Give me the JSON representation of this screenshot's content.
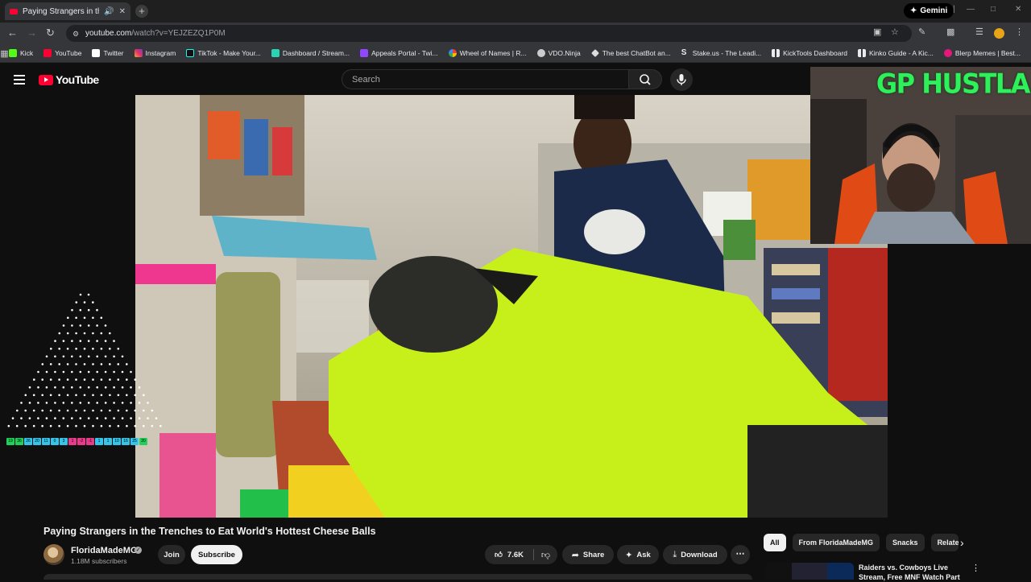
{
  "browser": {
    "tab_title": "Paying Strangers in the Tre",
    "url_host": "youtube.com",
    "url_path": "/watch?v=YEJZEZQ1P0M",
    "gemini_label": "Gemini",
    "bookmarks": [
      {
        "label": "Kick",
        "color": "#53fc18"
      },
      {
        "label": "YouTube",
        "color": "#ff0033"
      },
      {
        "label": "Twitter",
        "color": "#ffffff"
      },
      {
        "label": "Instagram",
        "color": "#e1306c"
      },
      {
        "label": "TikTok - Make Your...",
        "color": "#111111"
      },
      {
        "label": "Dashboard / Stream...",
        "color": "#2ad3b6"
      },
      {
        "label": "Appeals Portal - Twi...",
        "color": "#9146ff"
      },
      {
        "label": "Wheel of Names | R...",
        "color": "#4285f4"
      },
      {
        "label": "VDO.Ninja",
        "color": "#cccccc"
      },
      {
        "label": "The best ChatBot an...",
        "color": "#dddddd"
      },
      {
        "label": "Stake.us - The Leadi...",
        "color": "#e8eaed"
      },
      {
        "label": "KickTools Dashboard",
        "color": "#e8eaed"
      },
      {
        "label": "Kinko Guide - A Kic...",
        "color": "#e8eaed"
      },
      {
        "label": "Blerp Memes | Best...",
        "color": "#e5177b"
      }
    ]
  },
  "youtube": {
    "logo_text": "YouTube",
    "search_placeholder": "Search"
  },
  "overlay": {
    "cam_title": "GP HUSTLA",
    "counters": [
      "19",
      "36",
      "26",
      "20",
      "11",
      "0",
      "3",
      "1",
      "-2",
      "-1",
      "1",
      "1",
      "10",
      "16",
      "25",
      "20"
    ]
  },
  "video": {
    "title": "Paying Strangers in the Trenches to Eat World's Hottest Cheese Balls",
    "channel": "FloridaMadeMG",
    "subscribers": "1.18M subscribers",
    "join_label": "Join",
    "subscribe_label": "Subscribe",
    "likes": "7.6K",
    "share_label": "Share",
    "ask_label": "Ask",
    "download_label": "Download"
  },
  "sidebar": {
    "chips": [
      "All",
      "From FloridaMadeMG",
      "Snacks",
      "Relate"
    ],
    "rec_title": "Raiders vs. Cowboys Live Stream, Free MNF Watch Part"
  },
  "colors": {
    "yt_red": "#ff0033",
    "overlay_green": "#2ef05a",
    "background": "#0f0f0f"
  }
}
